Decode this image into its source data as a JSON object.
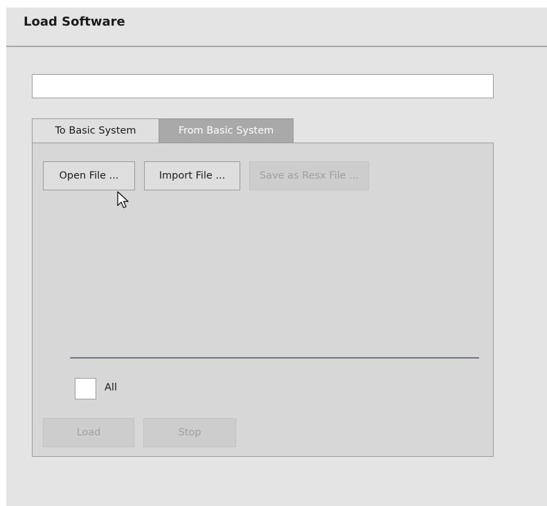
{
  "window": {
    "title": "Load Software"
  },
  "path_field": {
    "value": "",
    "placeholder": ""
  },
  "tabs": [
    {
      "label": "To Basic System",
      "selected": false
    },
    {
      "label": "From Basic System",
      "selected": true
    }
  ],
  "actions": {
    "open_file_label": "Open File ...",
    "import_file_label": "Import File ...",
    "save_resx_label": "Save as Resx File ...",
    "save_resx_enabled": false
  },
  "select_all": {
    "label": "All",
    "checked": false
  },
  "footer": {
    "load_label": "Load",
    "load_enabled": false,
    "stop_label": "Stop",
    "stop_enabled": false
  },
  "icons": {
    "cursor": "mouse-pointer-icon"
  },
  "colors": {
    "window_bg": "#e4e4e4",
    "panel_bg": "#d7d7d7",
    "selected_tab_bg": "#a9a9a9",
    "divider": "#6e7480",
    "disabled_text": "#a0a0a0"
  }
}
